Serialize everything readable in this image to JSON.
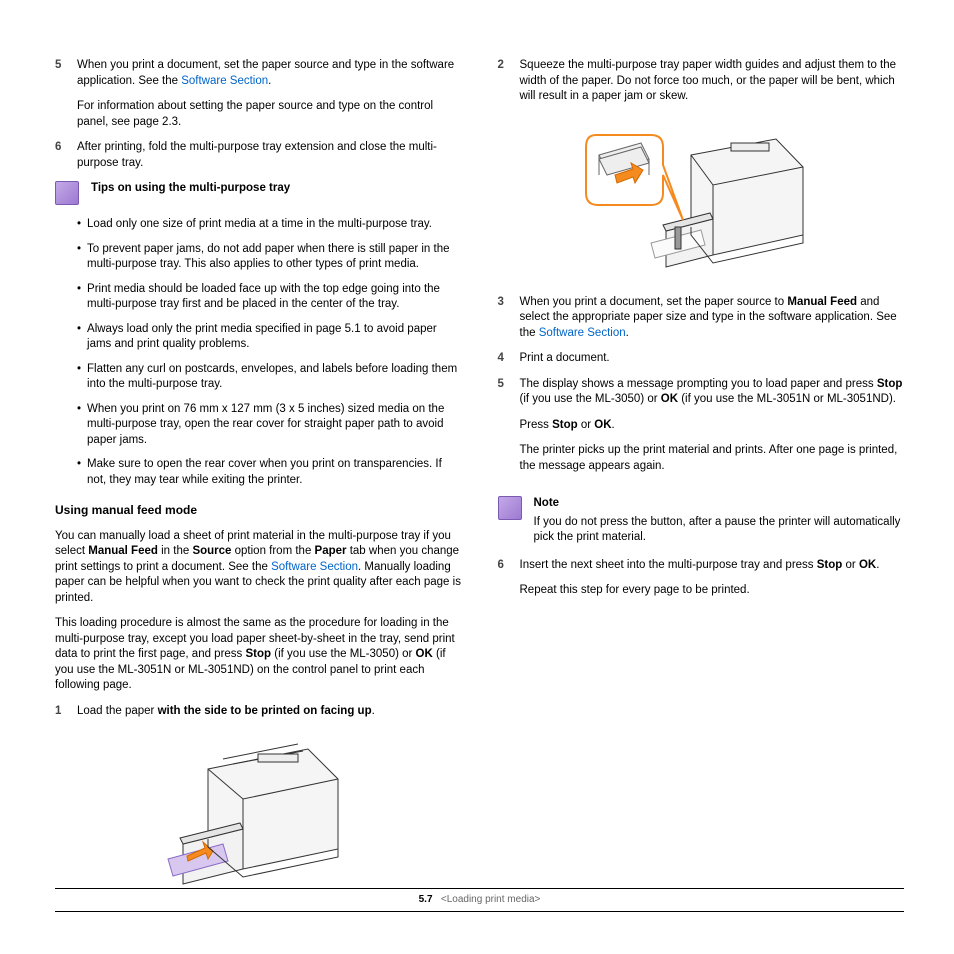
{
  "left": {
    "step5a": "When you print a document, set the paper source and type in the software application. See the ",
    "step5a_link": "Software Section",
    "step5b": "For information about setting the paper source and type on the control panel, see page 2.3.",
    "step6": "After printing, fold the multi-purpose tray extension and close the multi-purpose tray.",
    "tips_title": "Tips on using the multi-purpose tray",
    "tips": [
      "Load only one size of print media at a time in the multi-purpose tray.",
      "To prevent paper jams, do not add paper when there is still paper in the multi-purpose tray. This also applies to other types of print media.",
      "Print media should be loaded face up with the top edge going into the multi-purpose tray first and be placed in the center of the tray.",
      "Always load only the print media specified in page 5.1 to avoid paper jams and print quality problems.",
      "Flatten any curl on postcards, envelopes, and labels before loading them into the multi-purpose tray.",
      "When you print on 76 mm x 127 mm (3 x 5 inches) sized media on the multi-purpose tray, open the rear cover for straight paper path to avoid paper jams.",
      "Make sure to open the rear cover when you print on transparencies. If not, they may tear while exiting the printer."
    ],
    "manual_title": "Using manual feed mode",
    "manual_p1_a": "You can manually load a sheet of print material in the multi-purpose tray if you select ",
    "manual_p1_b": "Manual Feed",
    "manual_p1_c": " in the ",
    "manual_p1_d": "Source",
    "manual_p1_e": " option from the ",
    "manual_p1_f": "Paper",
    "manual_p1_g": " tab when you change print settings to print a document. See the ",
    "manual_p1_link": "Software Section",
    "manual_p1_h": ". Manually loading paper can be helpful when you want to check the print quality after each page is printed.",
    "manual_p2_a": "This loading procedure is almost the same as the procedure for loading in the multi-purpose tray, except you load paper sheet-by-sheet in the tray, send print data to print the first page, and press ",
    "manual_p2_stop": "Stop",
    "manual_p2_b": " (if you use the ML-3050) or ",
    "manual_p2_ok": "OK",
    "manual_p2_c": " (if you use the ML-3051N or ML-3051ND) on the control panel to print each following page.",
    "manual_step1_a": "Load the paper ",
    "manual_step1_b": "with the side to be printed on facing up"
  },
  "right": {
    "step2": "Squeeze the multi-purpose tray paper width guides and adjust them to the width of the paper. Do not force too much, or the paper will be bent, which will result in a paper jam or skew.",
    "step3_a": "When you print a document, set the paper source to ",
    "step3_b": "Manual Feed",
    "step3_c": " and select the appropriate paper size and type in the software application. See the ",
    "step3_link": "Software Section",
    "step4": "Print a document.",
    "step5_a": "The display shows a message prompting you to load paper and press ",
    "step5_stop": "Stop",
    "step5_b": " (if you use the ML-3050) or ",
    "step5_ok": "OK",
    "step5_c": " (if you use the ML-3051N or ML-3051ND).",
    "step5_d": "Press ",
    "step5_e": " or ",
    "step5_f": ".",
    "step5_g": "The printer picks up the print material and prints. After one page is printed, the message appears again.",
    "note_title": "Note",
    "note_body": "If you do not press the button, after a pause the printer will automatically pick the print material.",
    "step6_a": "Insert the next sheet into the multi-purpose tray and press ",
    "step6_stop": "Stop",
    "step6_b": " or ",
    "step6_ok": "OK",
    "step6_c": ".",
    "step6_d": "Repeat this step for every page to be printed."
  },
  "footer": {
    "page_prefix": "5",
    "page_num": ".7",
    "chapter": "<Loading print media>"
  }
}
